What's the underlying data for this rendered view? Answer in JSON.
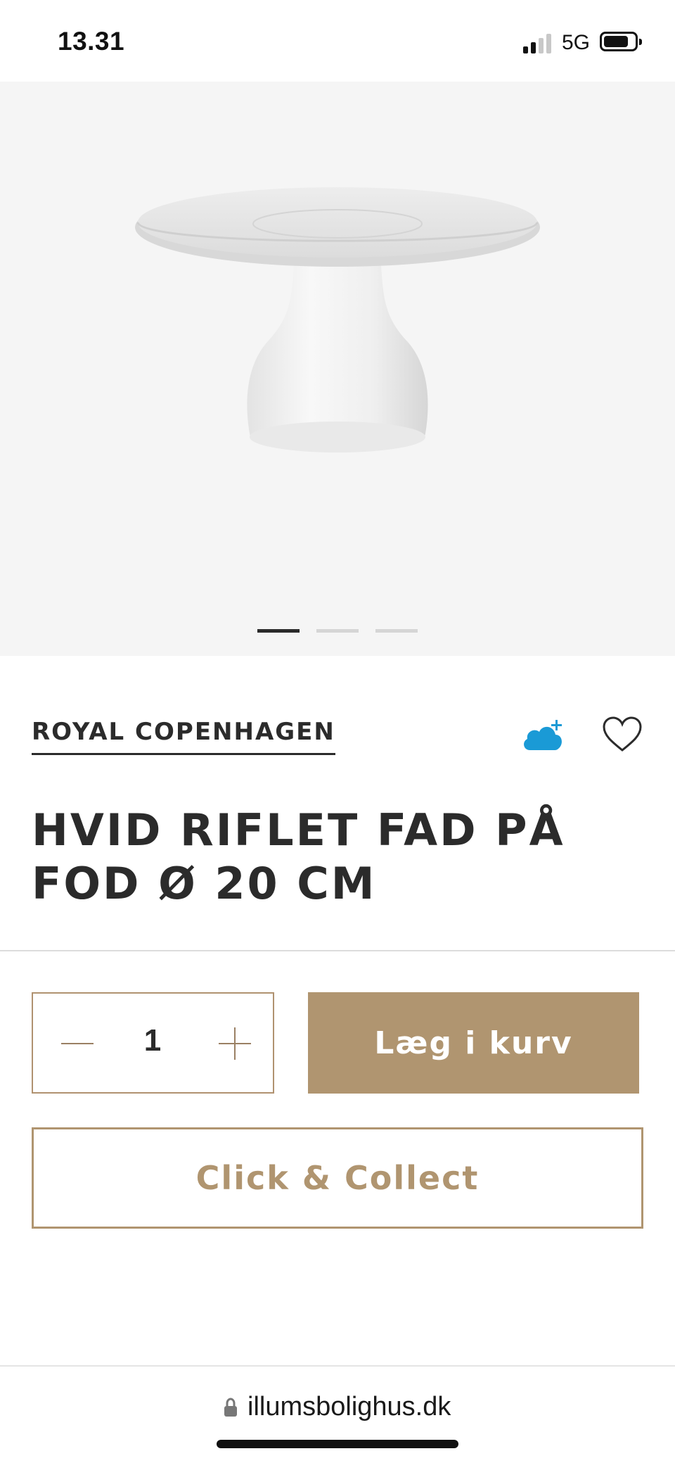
{
  "status_bar": {
    "time": "13.31",
    "network": "5G",
    "battery_level": 0.8
  },
  "gallery": {
    "image_count": 3,
    "active_index": 0
  },
  "product": {
    "brand": "ROYAL COPENHAGEN",
    "title": "HVID RIFLET FAD PÅ FOD Ø 20 CM",
    "quantity": "1"
  },
  "actions": {
    "add_to_cart_label": "Læg i kurv",
    "click_collect_label": "Click & Collect"
  },
  "icons": {
    "cloud": "cloud-plus-icon",
    "favorite": "heart-icon",
    "lock": "lock-icon"
  },
  "colors": {
    "accent": "#b09570",
    "cloud": "#1a9ad6",
    "text": "#2b2b2b"
  },
  "browser": {
    "url": "illumsbolighus.dk"
  }
}
